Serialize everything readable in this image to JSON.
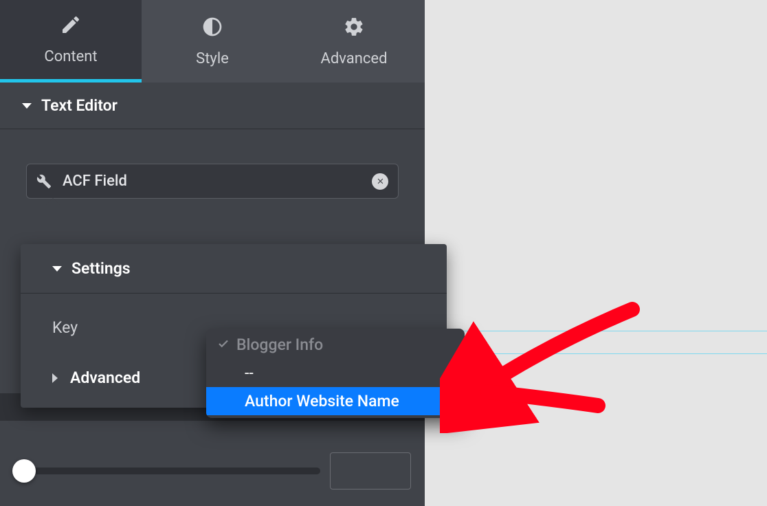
{
  "tabs": {
    "content": "Content",
    "style": "Style",
    "advanced": "Advanced"
  },
  "section": {
    "title": "Text Editor"
  },
  "field_selector": {
    "label": "ACF Field"
  },
  "popover": {
    "settings_title": "Settings",
    "key_label": "Key",
    "advanced_title": "Advanced"
  },
  "dropdown": {
    "group_label": "Blogger Info",
    "option_empty": "--",
    "option_selected": "Author Website Name"
  }
}
